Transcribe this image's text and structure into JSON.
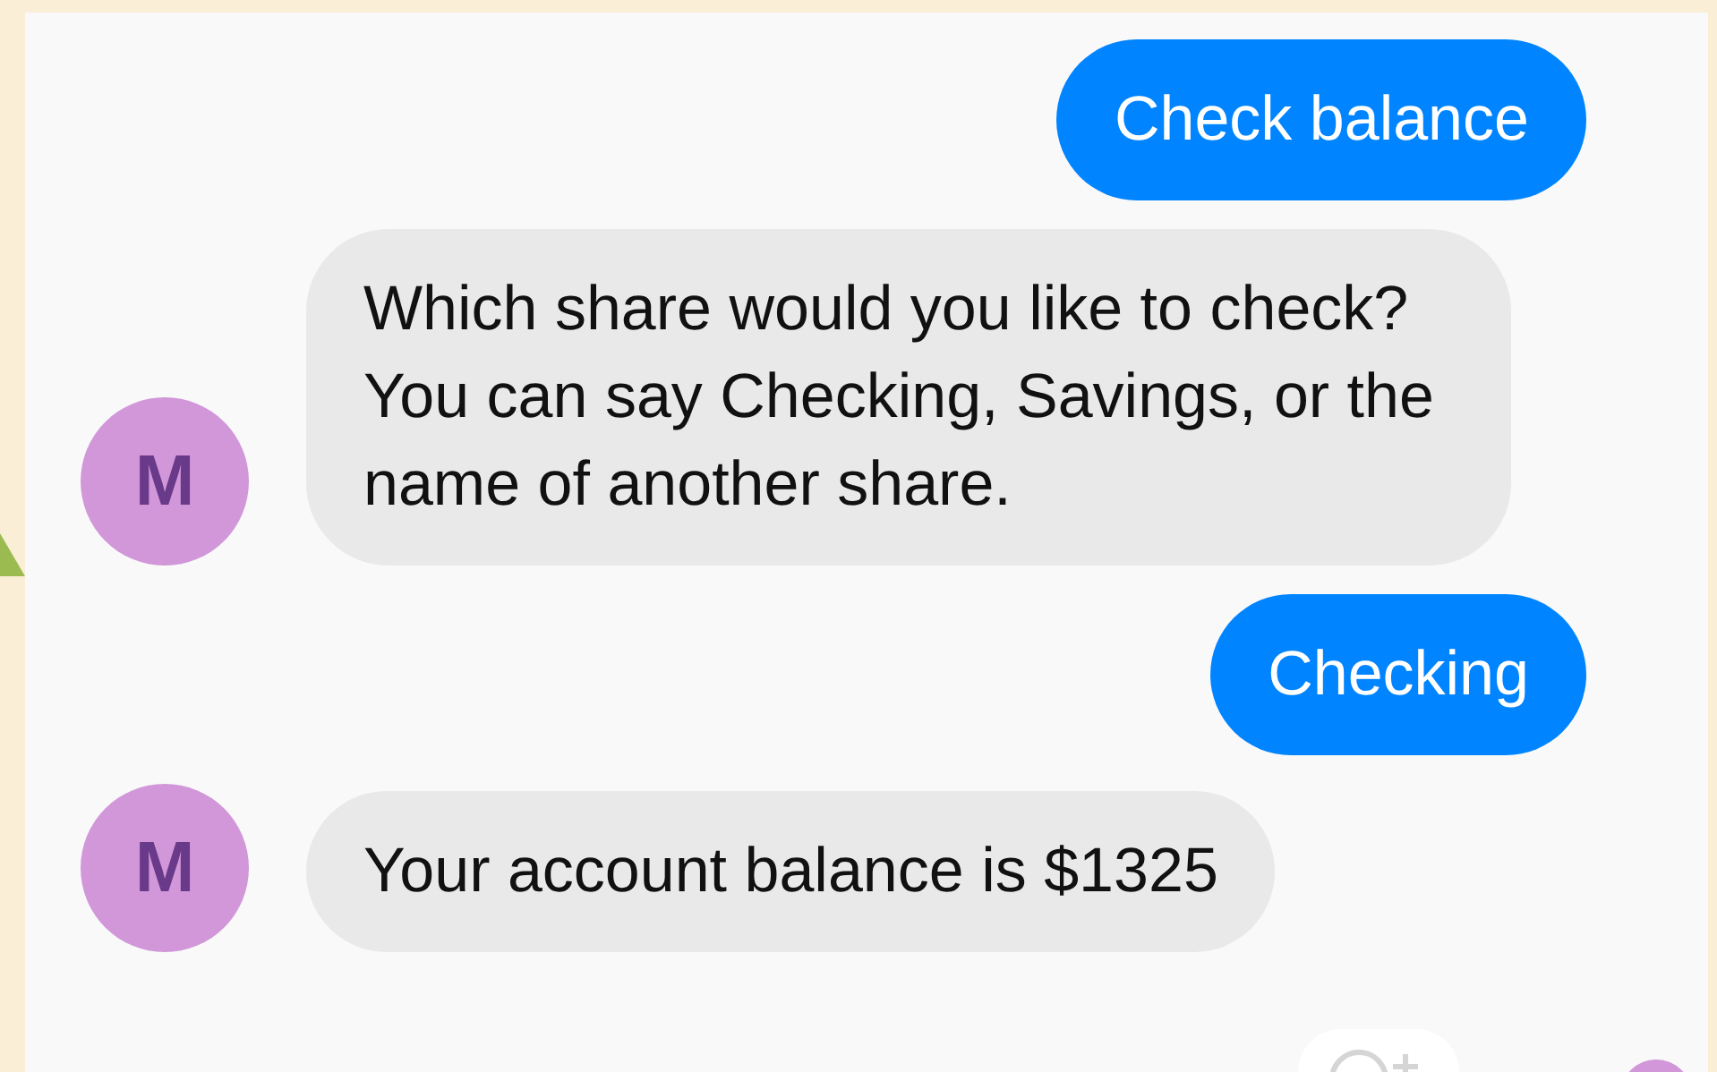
{
  "messages": [
    {
      "kind": "user",
      "text": "Check balance"
    },
    {
      "kind": "bot",
      "avatar": "M",
      "text": "Which share would you like to check? You can say Checking, Savings, or the name of another share."
    },
    {
      "kind": "user",
      "text": "Checking"
    },
    {
      "kind": "bot",
      "avatar": "M",
      "text": "Your account balance is $1325"
    }
  ]
}
